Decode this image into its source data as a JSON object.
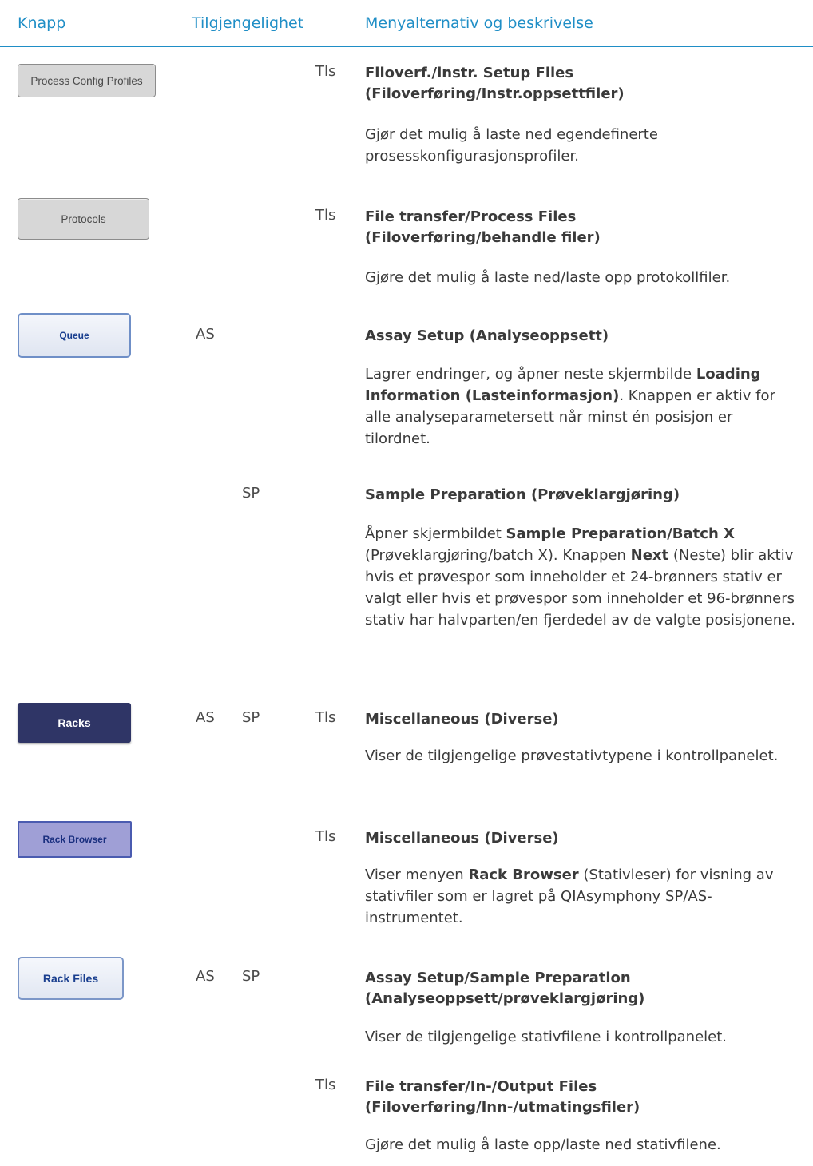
{
  "header": {
    "col_button": "Knapp",
    "col_availability": "Tilgjengelighet",
    "col_menu": "Menyalternativ og beskrivelse"
  },
  "rows": [
    {
      "button_label": "Process Config Profiles",
      "tls": "Tls",
      "title1": "Filoverf./instr. Setup Files",
      "title2": "(Filoverføring/Instr.oppsettfiler)",
      "desc": "Gjør det mulig å laste ned egendefinerte prosesskonfigurasjonsprofiler."
    },
    {
      "button_label": "Protocols",
      "tls": "Tls",
      "title1": "File transfer/Process Files",
      "title2": "(Filoverføring/behandle filer)",
      "desc": "Gjøre det mulig å laste ned/laste opp protokollfiler."
    },
    {
      "button_label": "Queue",
      "as": "AS",
      "title1": "Assay Setup (Analyseoppsett)",
      "desc_pre": "Lagrer endringer, og åpner neste skjermbilde ",
      "desc_bold": "Loading Information (Lasteinformasjon)",
      "desc_post": ". Knappen er aktiv for alle analyseparametersett når minst én posisjon er tilordnet."
    },
    {
      "sp": "SP",
      "title1": "Sample Preparation (Prøveklargjøring)",
      "desc_a": "Åpner skjermbildet ",
      "desc_bold1": "Sample Preparation/Batch X",
      "desc_b": " (Prøveklargjøring/batch X). Knappen ",
      "desc_bold2": "Next",
      "desc_c": " (Neste) blir aktiv hvis et prøvespor som inneholder et 24-brønners stativ er valgt eller hvis et prøvespor som inneholder et 96-brønners stativ har halvparten/en fjerdedel av de valgte posisjonene."
    },
    {
      "button_label": "Racks",
      "as": "AS",
      "sp": "SP",
      "tls": "Tls",
      "title1": "Miscellaneous (Diverse)",
      "desc": "Viser de tilgjengelige prøvestativtypene i kontrollpanelet."
    },
    {
      "button_label": "Rack Browser",
      "tls": "Tls",
      "title1": "Miscellaneous (Diverse)",
      "desc_pre": "Viser menyen ",
      "desc_bold": "Rack Browser",
      "desc_post": " (Stativleser) for visning av stativfiler som er lagret på QIAsymphony SP/AS-instrumentet."
    },
    {
      "button_label": "Rack Files",
      "as": "AS",
      "sp": "SP",
      "title1": "Assay Setup/Sample Preparation",
      "title2": "(Analyseoppsett/prøveklargjøring)",
      "desc": "Viser de tilgjengelige stativfilene i kontrollpanelet."
    },
    {
      "tls": "Tls",
      "title1": "File transfer/In-/Output Files",
      "title2": "(Filoverføring/Inn-/utmatingsfiler)",
      "desc": "Gjøre det mulig å laste opp/laste ned stativfilene."
    }
  ]
}
